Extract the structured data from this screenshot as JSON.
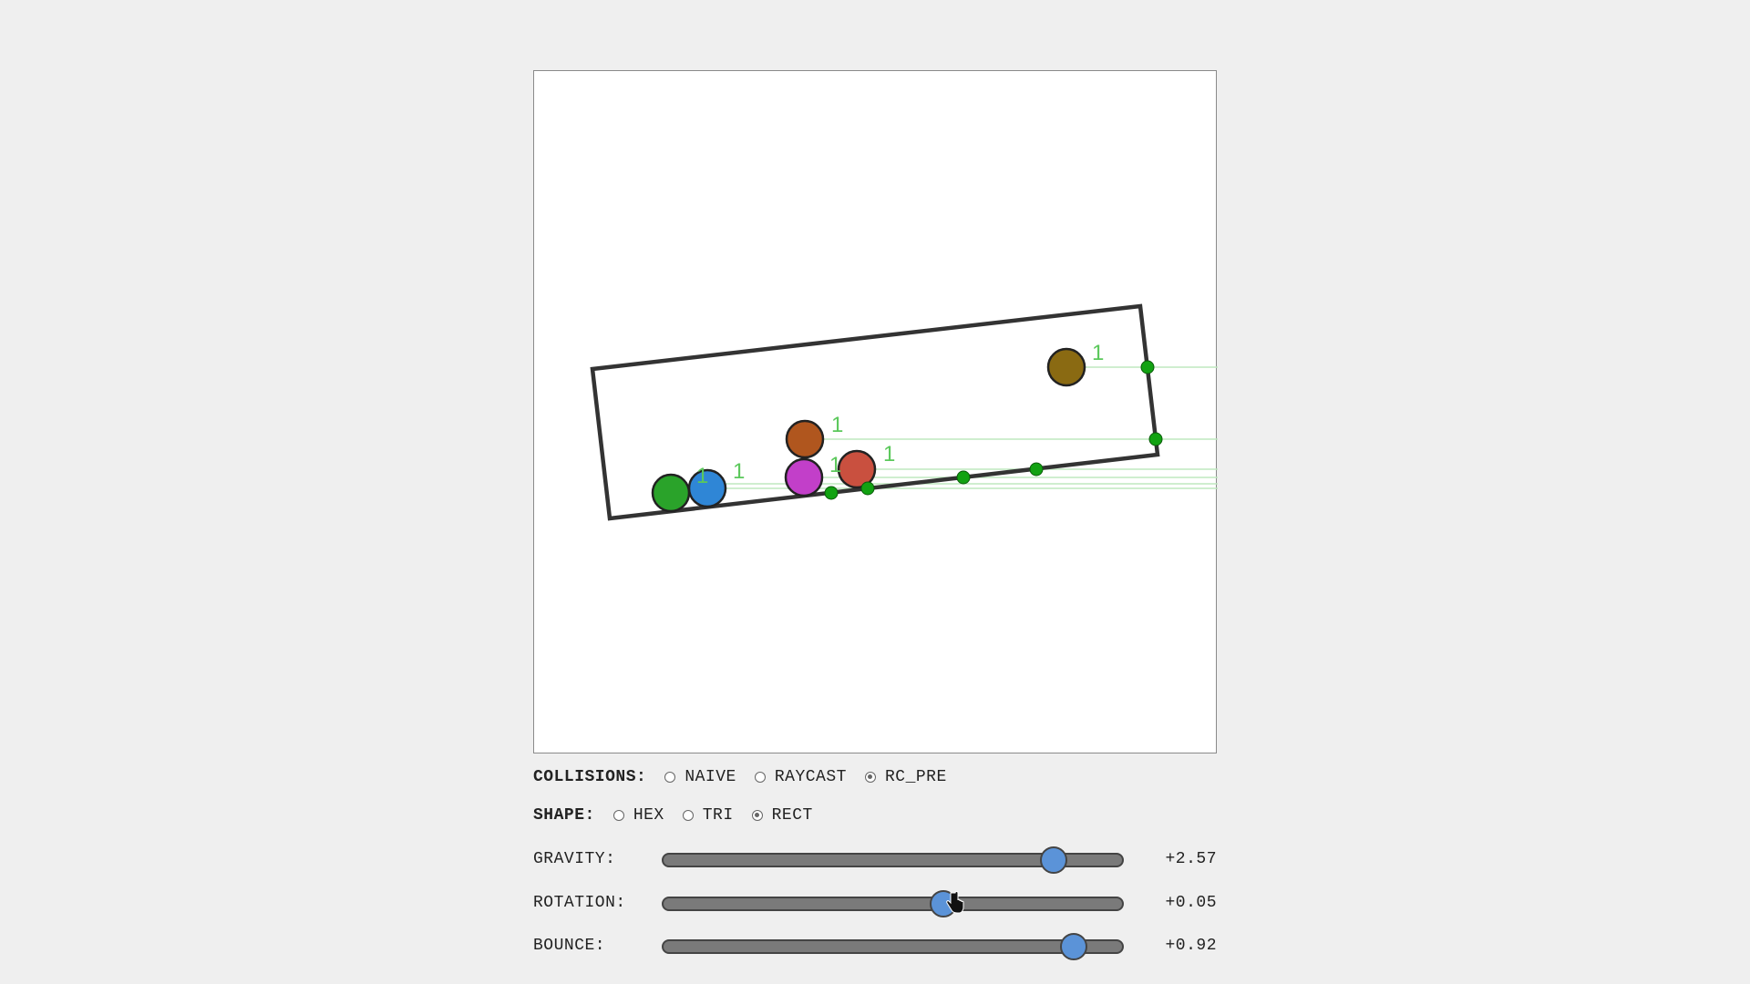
{
  "controls": {
    "collisions": {
      "label": "COLLISIONS:",
      "options": [
        "NAIVE",
        "RAYCAST",
        "RC_PRE"
      ],
      "selected": "RC_PRE"
    },
    "shape": {
      "label": "SHAPE:",
      "options": [
        "HEX",
        "TRI",
        "RECT"
      ],
      "selected": "RECT"
    },
    "gravity": {
      "label": "GRAVITY:",
      "value_text": "+2.57",
      "level": 0.85
    },
    "rotation": {
      "label": "ROTATION:",
      "value_text": "+0.05",
      "level": 0.61
    },
    "bounce": {
      "label": "BOUNCE:",
      "value_text": "+0.92",
      "level": 0.895
    }
  },
  "simulation": {
    "ball_label": "1",
    "colors": {
      "olive_ball": "#8a6a12",
      "orange_ball": "#b0561e",
      "magenta_ball": "#c23fc9",
      "red_ball": "#c9503f",
      "green_ball": "#2aa32a",
      "blue_ball": "#2f86d6",
      "ray_line": "#bfe8bf",
      "hit_point": "#12a212",
      "container_stroke": "#333333",
      "label_text": "#5bc85b"
    }
  }
}
